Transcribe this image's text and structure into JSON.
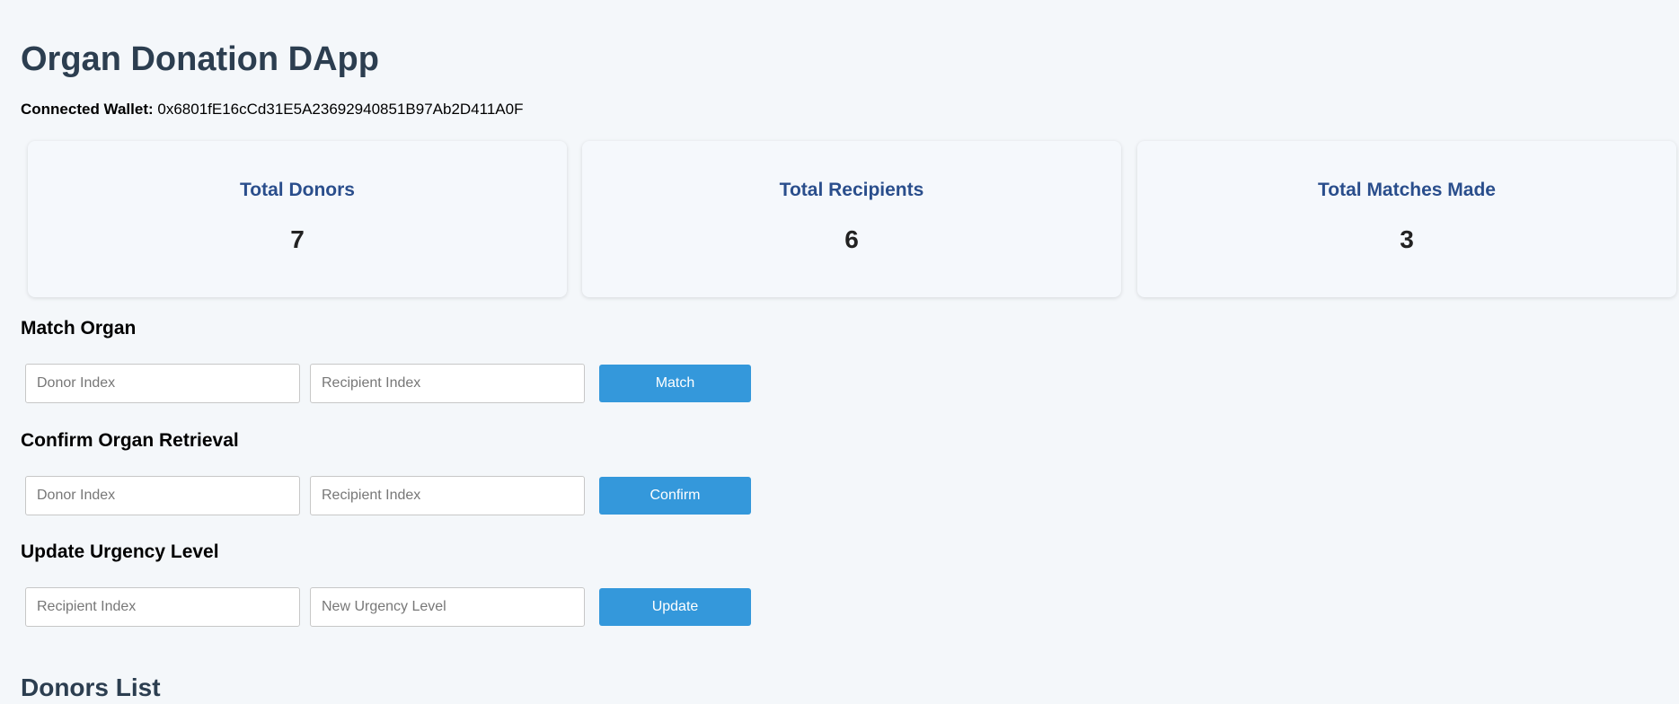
{
  "app": {
    "title": "Organ Donation DApp"
  },
  "wallet": {
    "label": "Connected Wallet:",
    "address": "0x6801fE16cCd31E5A23692940851B97Ab2D411A0F"
  },
  "stats": [
    {
      "title": "Total Donors",
      "value": "7"
    },
    {
      "title": "Total Recipients",
      "value": "6"
    },
    {
      "title": "Total Matches Made",
      "value": "3"
    }
  ],
  "match_organ": {
    "title": "Match Organ",
    "donor_placeholder": "Donor Index",
    "recipient_placeholder": "Recipient Index",
    "button_label": "Match"
  },
  "confirm_retrieval": {
    "title": "Confirm Organ Retrieval",
    "donor_placeholder": "Donor Index",
    "recipient_placeholder": "Recipient Index",
    "button_label": "Confirm"
  },
  "update_urgency": {
    "title": "Update Urgency Level",
    "recipient_placeholder": "Recipient Index",
    "urgency_placeholder": "New Urgency Level",
    "button_label": "Update"
  },
  "donors_list": {
    "title": "Donors List"
  },
  "colors": {
    "background": "#f4f7fa",
    "heading": "#2c3e50",
    "stat_title": "#2a4e8c",
    "button": "#3498db"
  }
}
